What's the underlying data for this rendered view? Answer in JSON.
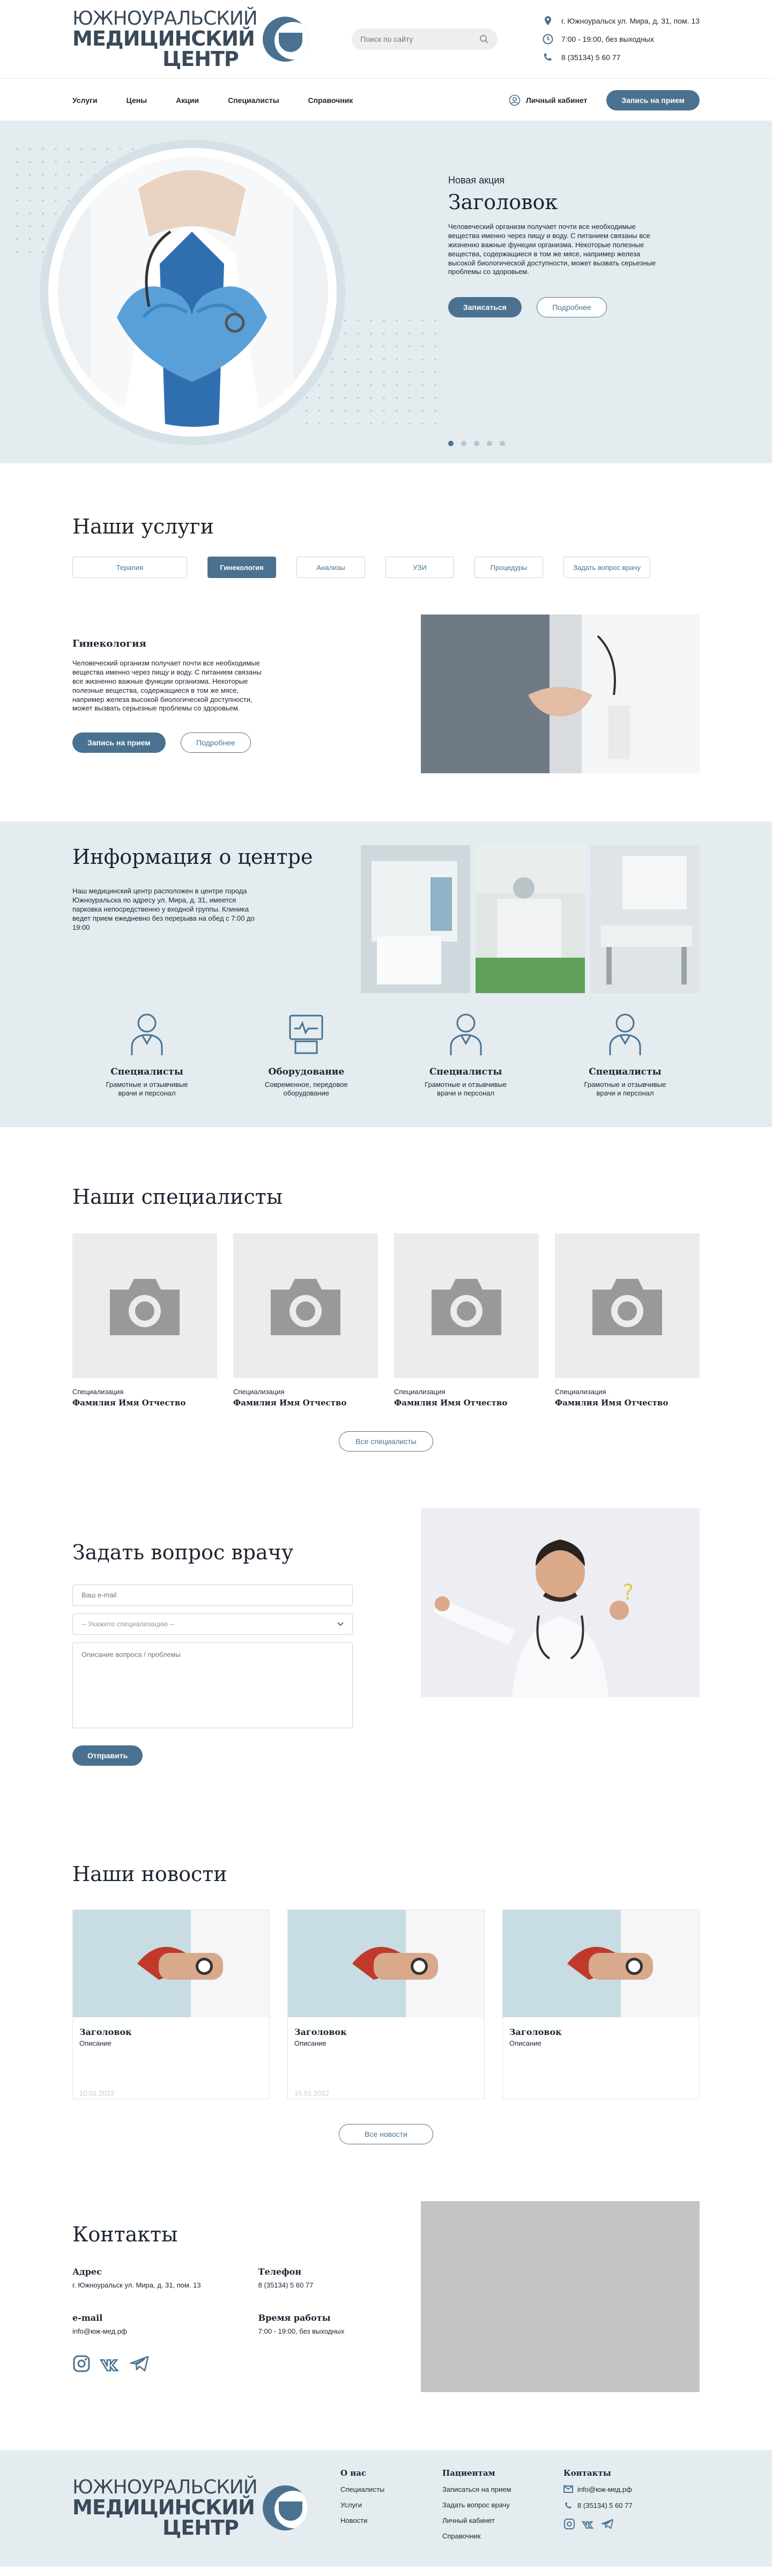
{
  "logo": {
    "line1": "ЮЖНОУРАЛЬСКИЙ",
    "line2": "МЕДИЦИНСКИЙ",
    "line3": "ЦЕНТР"
  },
  "search": {
    "placeholder": "Поиск по сайту"
  },
  "header_contacts": {
    "address": "г. Южноуральск ул. Мира, д. 31, пом. 13",
    "hours": "7:00 - 19:00, без выходных",
    "phone": "8 (35134) 5 60 77"
  },
  "nav": {
    "items": [
      "Услуги",
      "Цены",
      "Акции",
      "Специалисты",
      "Справочник"
    ],
    "cabinet": "Личный кабинет",
    "cta": "Запись на прием"
  },
  "hero": {
    "subtitle": "Новая акция",
    "title": "Заголовок",
    "text": "Человеческий организм получает почти все необходимые вещества именно через пищу и воду. С питанием связаны все жизненно важные функции организма. Некоторые полезные вещества, содержащиеся в том же мясе, например железа высокой биологической доступности, может вызвать серьезные проблемы со здоровьем.",
    "btn_primary": "Записаться",
    "btn_secondary": "Подробнее",
    "slides": 5,
    "active_slide": 1
  },
  "services": {
    "title": "Наши услуги",
    "tabs": [
      "Терапия",
      "Гинекология",
      "Анализы",
      "УЗИ",
      "Процедуры",
      "Задать вопрос врачу"
    ],
    "active_tab": "Гинекология",
    "heading": "Гинекология",
    "text": "Человеческий организм получает почти все необходимые вещества именно через пищу и воду. С питанием связаны все жизненно важные функции организма. Некоторые полезные вещества, содержащиеся в том же мясе, например железа высокой биологической доступности, может вызвать серьезные проблемы со здоровьем.",
    "btn_primary": "Запись на прием",
    "btn_secondary": "Подробнее"
  },
  "info": {
    "title": "Информация о центре",
    "text": "Наш медицинский центр расположен в центре города Южноуральска по адресу ул. Мира, д. 31, имеется парковка непосредственно у входной группы. Клиника ведет прием ежедневно без перерыва на обед с 7:00 до 19:00",
    "features": [
      {
        "title": "Специалисты",
        "text": "Грамотные и отзывчивые врачи и персонал"
      },
      {
        "title": "Оборудование",
        "text": "Современное, передовое оборудование"
      },
      {
        "title": "Специалисты",
        "text": "Грамотные и отзывчивые врачи и персонал"
      },
      {
        "title": "Специалисты",
        "text": "Грамотные и отзывчивые врачи и персонал"
      }
    ]
  },
  "specialists": {
    "title": "Наши специалисты",
    "cards": [
      {
        "role": "Специализация",
        "name": "Фамилия Имя Отчество"
      },
      {
        "role": "Специализация",
        "name": "Фамилия Имя Отчество"
      },
      {
        "role": "Специализация",
        "name": "Фамилия Имя Отчество"
      },
      {
        "role": "Специализация",
        "name": "Фамилия Имя Отчество"
      }
    ],
    "all_button": "Все специалисты"
  },
  "ask": {
    "title": "Задать вопрос врачу",
    "name_placeholder": "Ваш e-mail",
    "select_value": "-- Укажите специализацию --",
    "question_placeholder": "Описание вопроса / проблемы",
    "submit": "Отправить"
  },
  "news": {
    "title": "Наши новости",
    "cards": [
      {
        "title": "Заголовок",
        "desc": "Описание",
        "date": "10.01.2022"
      },
      {
        "title": "Заголовок",
        "desc": "Описание",
        "date": "10.01.2022"
      },
      {
        "title": "Заголовок",
        "desc": "Описание",
        "date": ""
      }
    ],
    "all_button": "Все новости"
  },
  "contacts": {
    "title": "Контакты",
    "address_label": "Адрес",
    "address": "г. Южноуральск ул. Мира, д. 31, пом. 13",
    "phone_label": "Телефон",
    "phone": "8 (35134) 5 60 77",
    "email_label": "e-mail",
    "email": "info@юж-мед.рф",
    "hours_label": "Время работы",
    "hours": "7:00 - 19:00, без выходных"
  },
  "footer": {
    "about": {
      "title": "О нас",
      "links": [
        "Специалисты",
        "Услуги",
        "Новости"
      ]
    },
    "patients": {
      "title": "Пациентам",
      "links": [
        "Записаться на прием",
        "Задать вопрос врачу",
        "Личный кабинет",
        "Справочник"
      ]
    },
    "contacts": {
      "title": "Контакты",
      "email": "info@юж-мед.рф",
      "phone": "8 (35134) 5 60 77"
    }
  },
  "colors": {
    "accent": "#4a7290",
    "light_bg": "#e4ecf0",
    "placeholder_bg": "#ececec",
    "map": "#c4c4c4"
  }
}
